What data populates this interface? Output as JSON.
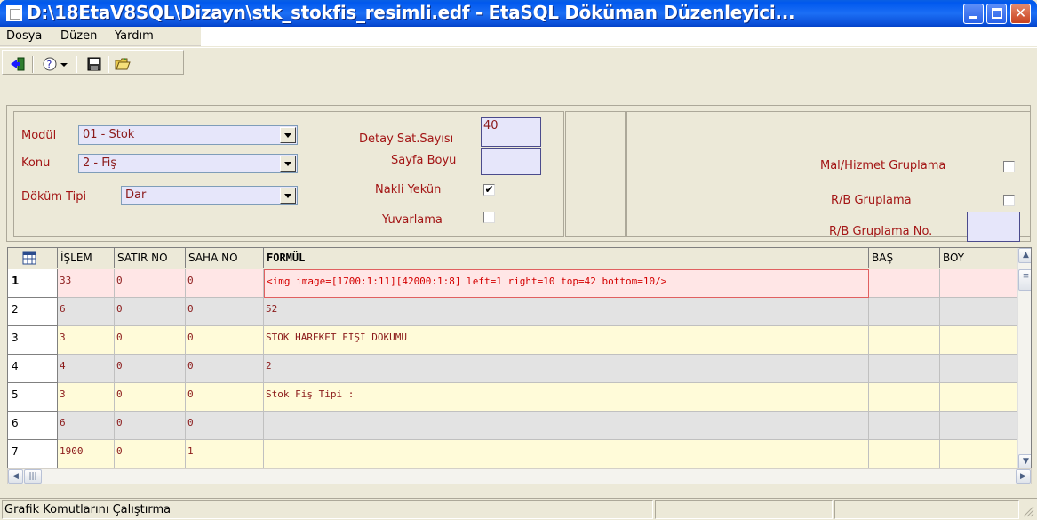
{
  "window": {
    "title": "D:\\18EtaV8SQL\\Dizayn\\stk_stokfis_resimli.edf - EtaSQL Döküman Düzenleyici..."
  },
  "menu": {
    "items": [
      "Dosya",
      "Düzen",
      "Yardım"
    ]
  },
  "toolbar": {
    "icons": [
      "exit-icon",
      "help-icon",
      "dropdown-arrow-icon",
      "save-icon",
      "open-folder-icon"
    ]
  },
  "form": {
    "modul_label": "Modül",
    "modul_value": "01 - Stok",
    "konu_label": "Konu",
    "konu_value": "2 - Fiş",
    "dokum_tipi_label": "Döküm Tipi",
    "dokum_tipi_value": "Dar",
    "detay_label": "Detay Sat.Sayısı",
    "detay_value": "40",
    "sayfa_boyu_label": "Sayfa Boyu",
    "sayfa_boyu_value": "",
    "nakli_label": "Nakli Yekün",
    "nakli_checked": "✔",
    "yuvarlama_label": "Yuvarlama",
    "mal_hizmet_label": "Mal/Hizmet Gruplama",
    "rb_gruplama_label": "R/B Gruplama",
    "rb_gruplama_no_label": "R/B Gruplama No.",
    "rb_gruplama_no_value": ""
  },
  "grid": {
    "headers": [
      "İŞLEM",
      "SATIR NO",
      "SAHA NO",
      "FORMÜL",
      "BAŞ",
      "BOY"
    ],
    "rows": [
      {
        "n": "1",
        "islem": "33",
        "satir": "0",
        "saha": "0",
        "formul": "<img image=[1700:1:11][42000:1:8] left=1 right=10 top=42 bottom=10/>",
        "bas": "",
        "boy": ""
      },
      {
        "n": "2",
        "islem": "6",
        "satir": "0",
        "saha": "0",
        "formul": "52",
        "bas": "",
        "boy": ""
      },
      {
        "n": "3",
        "islem": "3",
        "satir": "0",
        "saha": "0",
        "formul": "STOK HAREKET FİŞİ DÖKÜMÜ",
        "bas": "",
        "boy": ""
      },
      {
        "n": "4",
        "islem": "4",
        "satir": "0",
        "saha": "0",
        "formul": "2",
        "bas": "",
        "boy": ""
      },
      {
        "n": "5",
        "islem": "3",
        "satir": "0",
        "saha": "0",
        "formul": "Stok Fiş Tipi      :",
        "bas": "",
        "boy": ""
      },
      {
        "n": "6",
        "islem": "6",
        "satir": "0",
        "saha": "0",
        "formul": "",
        "bas": "",
        "boy": ""
      },
      {
        "n": "7",
        "islem": "1900",
        "satir": "0",
        "saha": "1",
        "formul": "",
        "bas": "",
        "boy": ""
      }
    ]
  },
  "status": {
    "text": "Grafik Komutlarını Çalıştırma"
  },
  "colors": {
    "row_yellow": "#fffbd9",
    "row_gray": "#e3e3e3",
    "row_selected": "#ffe6e6",
    "accent_text": "#8b1a1a"
  }
}
